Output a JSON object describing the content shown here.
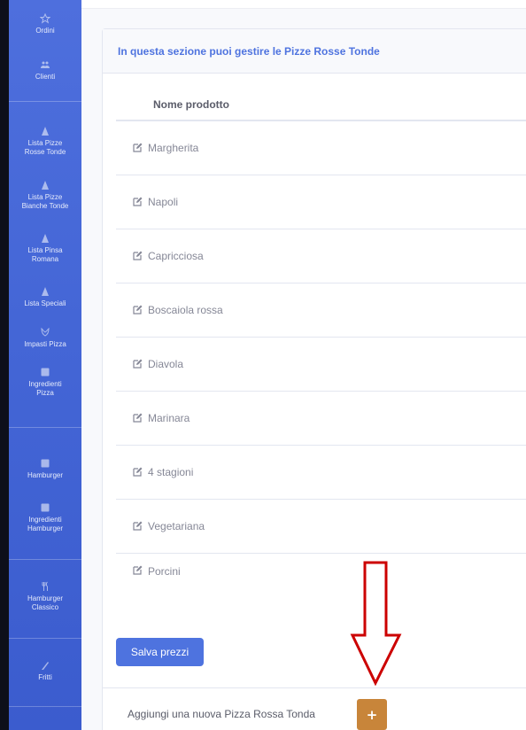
{
  "sidebar": {
    "items": [
      {
        "label": "Ordini",
        "icon": "star-icon"
      },
      {
        "label": "Clienti",
        "icon": "users-icon"
      },
      {
        "label": "Lista Pizze\nRosse Tonde",
        "icon": "pizza-icon"
      },
      {
        "label": "Lista Pizze\nBianche Tonde",
        "icon": "pizza-icon"
      },
      {
        "label": "Lista Pinsa\nRomana",
        "icon": "pizza-icon"
      },
      {
        "label": "Lista Speciali",
        "icon": "pizza-icon"
      },
      {
        "label": "Impasti Pizza",
        "icon": "wheat-icon"
      },
      {
        "label": "Ingredienti\nPizza",
        "icon": "box-icon"
      },
      {
        "label": "Hamburger",
        "icon": "box-icon"
      },
      {
        "label": "Ingredienti\nHamburger",
        "icon": "box-icon"
      },
      {
        "label": "Hamburger\nClassico",
        "icon": "utensils-icon"
      },
      {
        "label": "Fritti",
        "icon": "fries-icon"
      }
    ]
  },
  "main": {
    "card_title": "In questa sezione puoi gestire le Pizze Rosse Tonde",
    "table_header": "Nome prodotto",
    "products": [
      "Margherita",
      "Napoli",
      "Capricciosa",
      "Boscaiola rossa",
      "Diavola",
      "Marinara",
      "4 stagioni",
      "Vegetariana",
      "Porcini"
    ],
    "save_button": "Salva prezzi",
    "add_label": "Aggiungi una nuova Pizza Rossa Tonda",
    "add_button": "+"
  },
  "colors": {
    "sidebar": "#4e6fdd",
    "primary": "#4e73df",
    "add_button": "#c8853a",
    "arrow": "#cc0000"
  }
}
